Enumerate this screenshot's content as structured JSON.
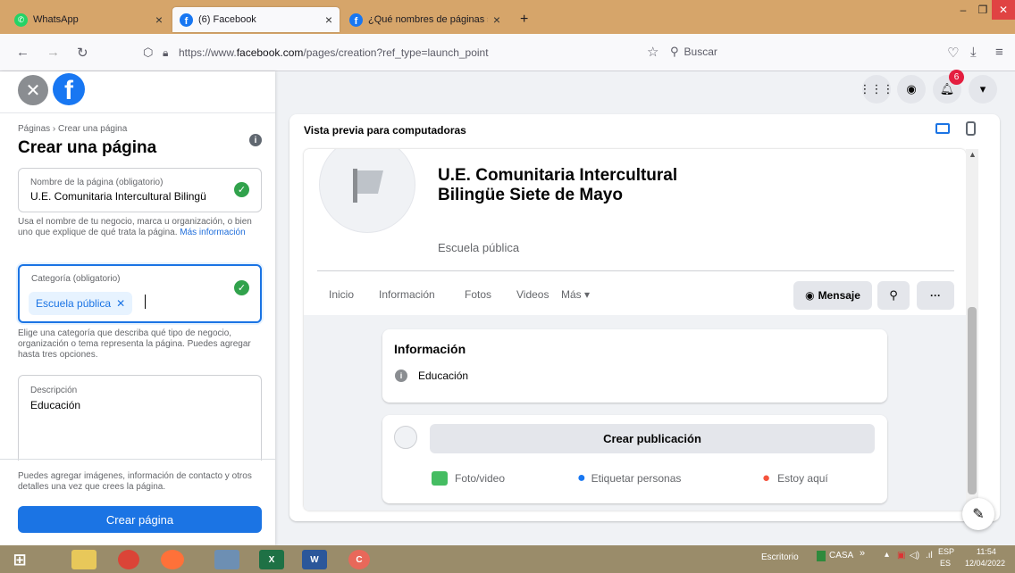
{
  "browser": {
    "tabs": [
      {
        "title": "WhatsApp",
        "favicon": "whatsapp-icon"
      },
      {
        "title": "(6) Facebook",
        "favicon": "facebook-icon"
      },
      {
        "title": "¿Qué nombres de páginas se ad",
        "favicon": "facebook-icon"
      }
    ],
    "new_tab": "+",
    "close_tab": "×",
    "url_prefix": "https://www.",
    "url_domain": "facebook.com",
    "url_path": "/pages/creation?ref_type=launch_point",
    "search_placeholder": "Buscar",
    "accent": "#d6a56a"
  },
  "left": {
    "breadcrumb": "Páginas › Crear una página",
    "title": "Crear una página",
    "name_label": "Nombre de la página (obligatorio)",
    "name_value": "U.E. Comunitaria Intercultural Bilingü",
    "name_help": "Usa el nombre de tu negocio, marca u organización, o bien uno que explique de qué trata la página.",
    "name_help_link": "Más información",
    "category_label": "Categoría (obligatorio)",
    "category_chip": "Escuela pública",
    "category_help": "Elige una categoría que describa qué tipo de negocio, organización o tema representa la página. Puedes agregar hasta tres opciones.",
    "description_label": "Descripción",
    "description_value": "Educación",
    "footer_note": "Puedes agregar imágenes, información de contacto y otros detalles una vez que crees la página.",
    "create_button": "Crear página",
    "brand_color": "#1b74e4"
  },
  "topbar": {
    "notification_count": "6"
  },
  "preview": {
    "label": "Vista previa para computadoras",
    "page_name": "U.E. Comunitaria Intercultural Bilingüe Siete de Mayo",
    "category": "Escuela pública",
    "nav_tabs": [
      "Inicio",
      "Información",
      "Fotos",
      "Videos",
      "Más ▾"
    ],
    "message_button": "Mensaje",
    "info_title": "Información",
    "info_item": "Educación",
    "create_post": "Crear publicación",
    "actions": [
      "Foto/video",
      "Etiquetar personas",
      "Estoy aquí"
    ]
  },
  "taskbar": {
    "desktop_label": "Escritorio",
    "casa_label": "CASA",
    "chevron": "»",
    "lang_top": "ESP",
    "lang_bottom": "ES",
    "time": "11:54",
    "date": "12/04/2022"
  }
}
